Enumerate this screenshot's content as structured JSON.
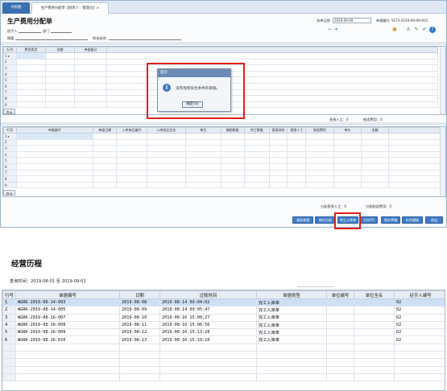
{
  "tabs": [
    {
      "label": "导航图"
    },
    {
      "label": "生产费用分配单【制单人：管理员】×"
    }
  ],
  "doc": {
    "title": "生产费用分配单",
    "handler_label": "经手人",
    "dept_label": "部门",
    "summary_label": "摘要",
    "note_label": "附加说明",
    "date_label": "录单日期",
    "date_value": "2019-09-09",
    "number_label": "单据编号",
    "number_value": "SCFY-2019-09-09-001"
  },
  "icons": {
    "nav_prev": "←",
    "nav_next": "➔",
    "tool1": "▣",
    "tool2": "♙",
    "tool3": "✎",
    "tool4": "✔",
    "tool5": "?"
  },
  "grid1": {
    "headers": [
      "行号",
      "费用类型",
      "金额",
      "单据备注"
    ],
    "rows": [
      "1",
      "2",
      "3",
      "4",
      "5",
      "6",
      "7",
      "8",
      "9"
    ],
    "total": "合计",
    "direct_labor": "直接人工：0",
    "mfg_cost": "制造费用：0"
  },
  "grid2": {
    "headers": [
      "行号",
      "单据编号",
      "单据日期",
      "入库商品编号",
      "入库商品全名",
      "单位",
      "辅助数量",
      "完工数量",
      "直接材料",
      "直接人工",
      "制造费用",
      "单价",
      "金额"
    ],
    "rows": [
      "1",
      "2",
      "3",
      "4",
      "5",
      "6",
      "7",
      "8",
      "9"
    ],
    "total": "合计",
    "alloc_direct": "分配直接人工：0",
    "alloc_mfg": "分配制造费用：0"
  },
  "buttons": [
    "清除表格",
    "按比分配",
    "完工入库单",
    "打印(P)",
    "保存草稿",
    "存为模板",
    "退出"
  ],
  "dialog": {
    "title": "提示",
    "message": "没有找到符合条件的单据。",
    "ok": "确定(O)"
  },
  "history": {
    "title": "经营历程",
    "query_label": "查询时间：",
    "date_from": "2019-08-01",
    "to_label": "至",
    "date_to": "2019-09-01",
    "headers": [
      "行号",
      "单据编号",
      "日期",
      "过账时间",
      "单据类型",
      "单位编号",
      "单位全名",
      "经手人编号"
    ],
    "rows": [
      {
        "no": "1",
        "code": "WGRK-2019-08-14-003",
        "date": "2019-08-08",
        "post": "2019-08-14 09:04:02",
        "type": "完工入库单",
        "unit_code": "",
        "unit_name": "",
        "handler": "02"
      },
      {
        "no": "2",
        "code": "WGRK-2019-08-14-005",
        "date": "2019-08-09",
        "post": "2019-08-14 09:05:47",
        "type": "完工入库单",
        "unit_code": "",
        "unit_name": "",
        "handler": "02"
      },
      {
        "no": "3",
        "code": "WGRK-2019-08-16-007",
        "date": "2019-08-10",
        "post": "2019-08-16 15:00:27",
        "type": "完工入库单",
        "unit_code": "",
        "unit_name": "",
        "handler": "02"
      },
      {
        "no": "4",
        "code": "WGRK-2019-08-16-008",
        "date": "2019-08-11",
        "post": "2019-08-16 15:06:56",
        "type": "完工入库单",
        "unit_code": "",
        "unit_name": "",
        "handler": "02"
      },
      {
        "no": "5",
        "code": "WGRK-2019-08-16-009",
        "date": "2019-08-12",
        "post": "2019-08-16 15:13:28",
        "type": "完工入库单",
        "unit_code": "",
        "unit_name": "",
        "handler": "02"
      },
      {
        "no": "6",
        "code": "WGRK-2019-08-16-010",
        "date": "2019-08-13",
        "post": "2019-08-16 15:19:10",
        "type": "完工入库单",
        "unit_code": "",
        "unit_name": "",
        "handler": "02"
      }
    ]
  },
  "colors": {
    "accent": "#3f7cc6",
    "highlight": "#e0201a",
    "selected_row": "#cfe0f5"
  }
}
